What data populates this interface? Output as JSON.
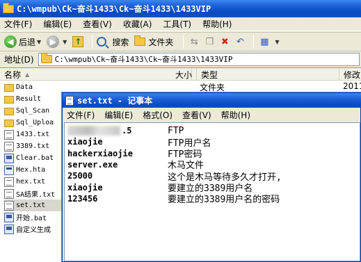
{
  "explorer": {
    "title": "C:\\wmpub\\Ck~奋斗1433\\Ck~奋斗1433\\1433VIP",
    "menu": [
      "文件(F)",
      "编辑(E)",
      "查看(V)",
      "收藏(A)",
      "工具(T)",
      "帮助(H)"
    ],
    "toolbar": {
      "back_label": "后退",
      "search_label": "搜索",
      "folders_label": "文件夹"
    },
    "address": {
      "label": "地址(D)",
      "value": "C:\\wmpub\\Ck~奋斗1433\\Ck~奋斗1433\\1433VIP"
    },
    "columns": {
      "name": "名称",
      "size": "大小",
      "type": "类型",
      "modified": "修改"
    },
    "first_row_type": "文件夹",
    "first_row_modified": "2011-",
    "files": [
      {
        "name": "Data",
        "icon": "folder-icon"
      },
      {
        "name": "Result",
        "icon": "folder-icon"
      },
      {
        "name": "Sql_Scan",
        "icon": "folder-icon"
      },
      {
        "name": "Sql_Uploa",
        "icon": "folder-icon"
      },
      {
        "name": "1433.txt",
        "icon": "text-file-icon"
      },
      {
        "name": "3389.txt",
        "icon": "text-file-icon"
      },
      {
        "name": "Clear.bat",
        "icon": "batch-file-icon"
      },
      {
        "name": "Hex.hta",
        "icon": "hta-file-icon"
      },
      {
        "name": "hex.txt",
        "icon": "text-file-icon"
      },
      {
        "name": "SA结果.txt",
        "icon": "text-file-icon"
      },
      {
        "name": "set.txt",
        "icon": "text-file-icon"
      },
      {
        "name": "开始.bat",
        "icon": "batch-file-icon"
      },
      {
        "name": "自定义生成",
        "icon": "batch-file-icon"
      }
    ],
    "selected_file": "set.txt"
  },
  "notepad": {
    "title": "set.txt - 记事本",
    "menu": [
      "文件(F)",
      "编辑(E)",
      "格式(O)",
      "查看(V)",
      "帮助(H)"
    ],
    "lines": [
      {
        "key": ".5",
        "note": "FTP",
        "redacted": true
      },
      {
        "key": "xiaojie",
        "note": "FTP用户名"
      },
      {
        "key": "hackerxiaojie",
        "note": "FTP密码"
      },
      {
        "key": "server.exe",
        "note": "木马文件"
      },
      {
        "key": "25000",
        "note": "这个是木马等待多久才打开,"
      },
      {
        "key": "xiaojie",
        "note": "要建立的3389用户名"
      },
      {
        "key": "123456",
        "note": "要建立的3389用户名的密码"
      }
    ]
  },
  "colors": {
    "title_bar": "#0a4ac0",
    "chrome": "#ece9d8",
    "selection": "#d8d7cf"
  }
}
